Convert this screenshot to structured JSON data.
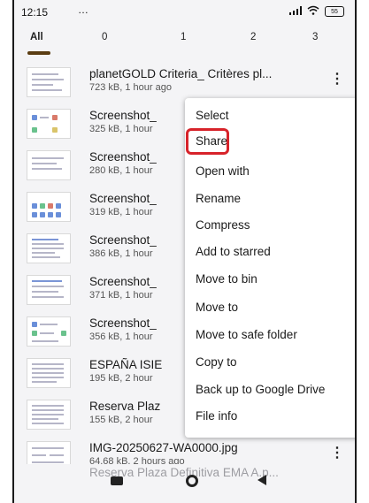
{
  "status_bar": {
    "time": "12:15",
    "notification_icons": "…",
    "battery_level": "55"
  },
  "tabs": [
    {
      "label": "All"
    },
    {
      "label": "0"
    },
    {
      "label": "1"
    },
    {
      "label": "2"
    },
    {
      "label": "3"
    }
  ],
  "files": [
    {
      "name": "planetGOLD Criteria_ Critères pl...",
      "meta": "723 kB, 1 hour ago"
    },
    {
      "name": "Screenshot_",
      "meta": "325 kB, 1 hour"
    },
    {
      "name": "Screenshot_",
      "meta": "280 kB, 1 hour"
    },
    {
      "name": "Screenshot_",
      "meta": "319 kB, 1 hour"
    },
    {
      "name": "Screenshot_",
      "meta": "386 kB, 1 hour"
    },
    {
      "name": "Screenshot_",
      "meta": "371 kB, 1 hour"
    },
    {
      "name": "Screenshot_",
      "meta": "356 kB, 1 hour"
    },
    {
      "name": "ESPAÑA ISIE",
      "meta": "195 kB, 2 hour"
    },
    {
      "name": "Reserva Plaz",
      "meta": "155 kB, 2 hour"
    },
    {
      "name": "IMG-20250627-WA0000.jpg",
      "meta": "64.68 kB, 2 hours ago"
    }
  ],
  "last_row_partial": "Reserva Plaza Definitiva EMA A.p...",
  "context_menu": [
    {
      "label": "Select"
    },
    {
      "label": "Share"
    },
    {
      "label": "Open with"
    },
    {
      "label": "Rename"
    },
    {
      "label": "Compress"
    },
    {
      "label": "Add to starred"
    },
    {
      "label": "Move to bin"
    },
    {
      "label": "Move to"
    },
    {
      "label": "Move to safe folder"
    },
    {
      "label": "Copy to"
    },
    {
      "label": "Back up to Google Drive"
    },
    {
      "label": "File info"
    }
  ],
  "highlight_color": "#d7232a",
  "tab_indicator_color": "#5b3d12"
}
